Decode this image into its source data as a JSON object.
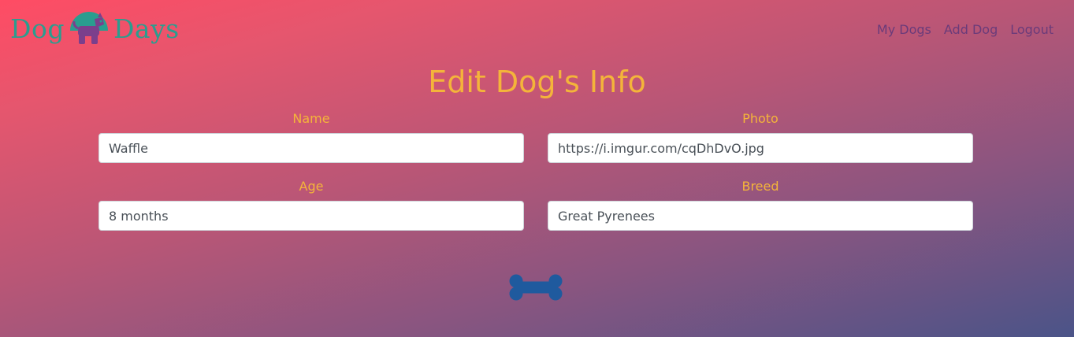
{
  "brand": {
    "left_text": "Dog",
    "right_text": "Days"
  },
  "nav": {
    "items": [
      "My Dogs",
      "Add Dog",
      "Logout"
    ]
  },
  "page": {
    "title": "Edit Dog's Info"
  },
  "form": {
    "name": {
      "label": "Name",
      "value": "Waffle"
    },
    "photo": {
      "label": "Photo",
      "value": "https://i.imgur.com/cqDhDvO.jpg"
    },
    "age": {
      "label": "Age",
      "value": "8 months"
    },
    "breed": {
      "label": "Breed",
      "value": "Great Pyrenees"
    }
  },
  "icons": {
    "logo": "dog-with-bone-icon",
    "submit": "bone-icon"
  },
  "colors": {
    "accent": "#f4b43a",
    "brand_teal": "#2a9d8f",
    "nav_purple": "#6a3b7a",
    "bone_blue": "#1f5a9e",
    "gradient_top": "#ff4c64",
    "gradient_bottom": "#4b5488"
  }
}
